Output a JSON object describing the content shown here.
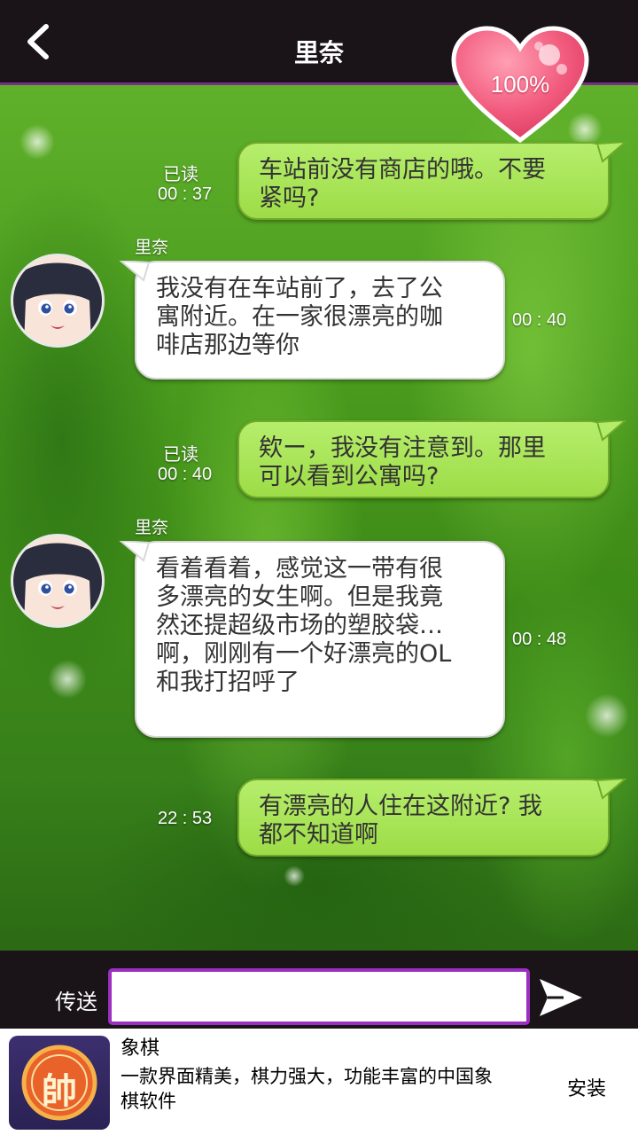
{
  "header": {
    "back_icon": "chevron-left-icon",
    "title": "里奈",
    "affection": "100%"
  },
  "messages": [
    {
      "direction": "out",
      "status": "已读",
      "time": "00 : 37",
      "text_lines": [
        "车站前没有商店的哦。不要",
        "紧吗?"
      ]
    },
    {
      "direction": "in",
      "sender": "里奈",
      "time": "00 : 40",
      "text_lines": [
        "我没有在车站前了，去了公",
        "寓附近。在一家很漂亮的咖",
        "啡店那边等你"
      ]
    },
    {
      "direction": "out",
      "status": "已读",
      "time": "00 : 40",
      "text_lines": [
        "欸ー，我没有注意到。那里",
        "可以看到公寓吗?"
      ]
    },
    {
      "direction": "in",
      "sender": "里奈",
      "time": "00 : 48",
      "text_lines": [
        "看着看着，感觉这一带有很",
        "多漂亮的女生啊。但是我竟",
        "然还提超级市场的塑胶袋…",
        "啊，刚刚有一个好漂亮的OL",
        "和我打招呼了"
      ]
    },
    {
      "direction": "out",
      "status": "",
      "time": "22 : 53",
      "text_lines": [
        "有漂亮的人住在这附近? 我",
        "都不知道啊"
      ]
    }
  ],
  "composer": {
    "send_label": "传送",
    "input_value": "",
    "input_placeholder": "",
    "send_icon": "paper-plane-icon"
  },
  "ad": {
    "icon_char": "帥",
    "title": "象棋",
    "description_lines": [
      "一款界面精美，棋力强大，功能丰富的中国象",
      "棋软件"
    ],
    "install_label": "安装"
  },
  "colors": {
    "header_bg": "#1a1418",
    "accent_purple": "#9b30c0",
    "bubble_out": "#a8e45a",
    "bubble_in": "#ffffff",
    "heart": "#f0557a"
  }
}
